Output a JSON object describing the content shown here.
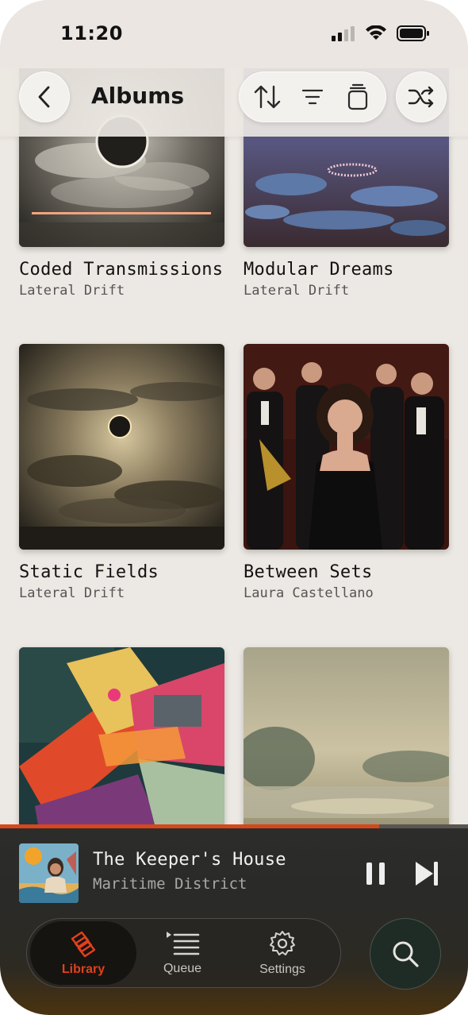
{
  "status_bar": {
    "time": "11:20",
    "icons": [
      "cellular-signal-icon",
      "wifi-icon",
      "battery-icon"
    ]
  },
  "header": {
    "title": "Albums",
    "back_icon": "chevron-left-icon",
    "tools": [
      "sort-icon",
      "filter-icon",
      "stack-icon"
    ],
    "shuffle_icon": "shuffle-icon"
  },
  "albums": [
    {
      "title": "Coded Transmissions",
      "artist": "Lateral Drift"
    },
    {
      "title": "Modular Dreams",
      "artist": "Lateral Drift"
    },
    {
      "title": "Static Fields",
      "artist": "Lateral Drift"
    },
    {
      "title": "Between Sets",
      "artist": "Laura Castellano"
    },
    {
      "title": "",
      "artist": ""
    },
    {
      "title": "",
      "artist": ""
    }
  ],
  "now_playing": {
    "title": "The Keeper's House",
    "artist": "Maritime District",
    "progress": 0.81,
    "pause_icon": "pause-icon",
    "next_icon": "skip-next-icon"
  },
  "tabs": [
    {
      "label": "Library",
      "icon": "library-icon",
      "active": true
    },
    {
      "label": "Queue",
      "icon": "queue-icon",
      "active": false
    },
    {
      "label": "Settings",
      "icon": "gear-icon",
      "active": false
    }
  ],
  "search_icon": "search-icon",
  "colors": {
    "accent": "#e2401c",
    "progress": "#d8461c",
    "background": "#ece8e3"
  }
}
